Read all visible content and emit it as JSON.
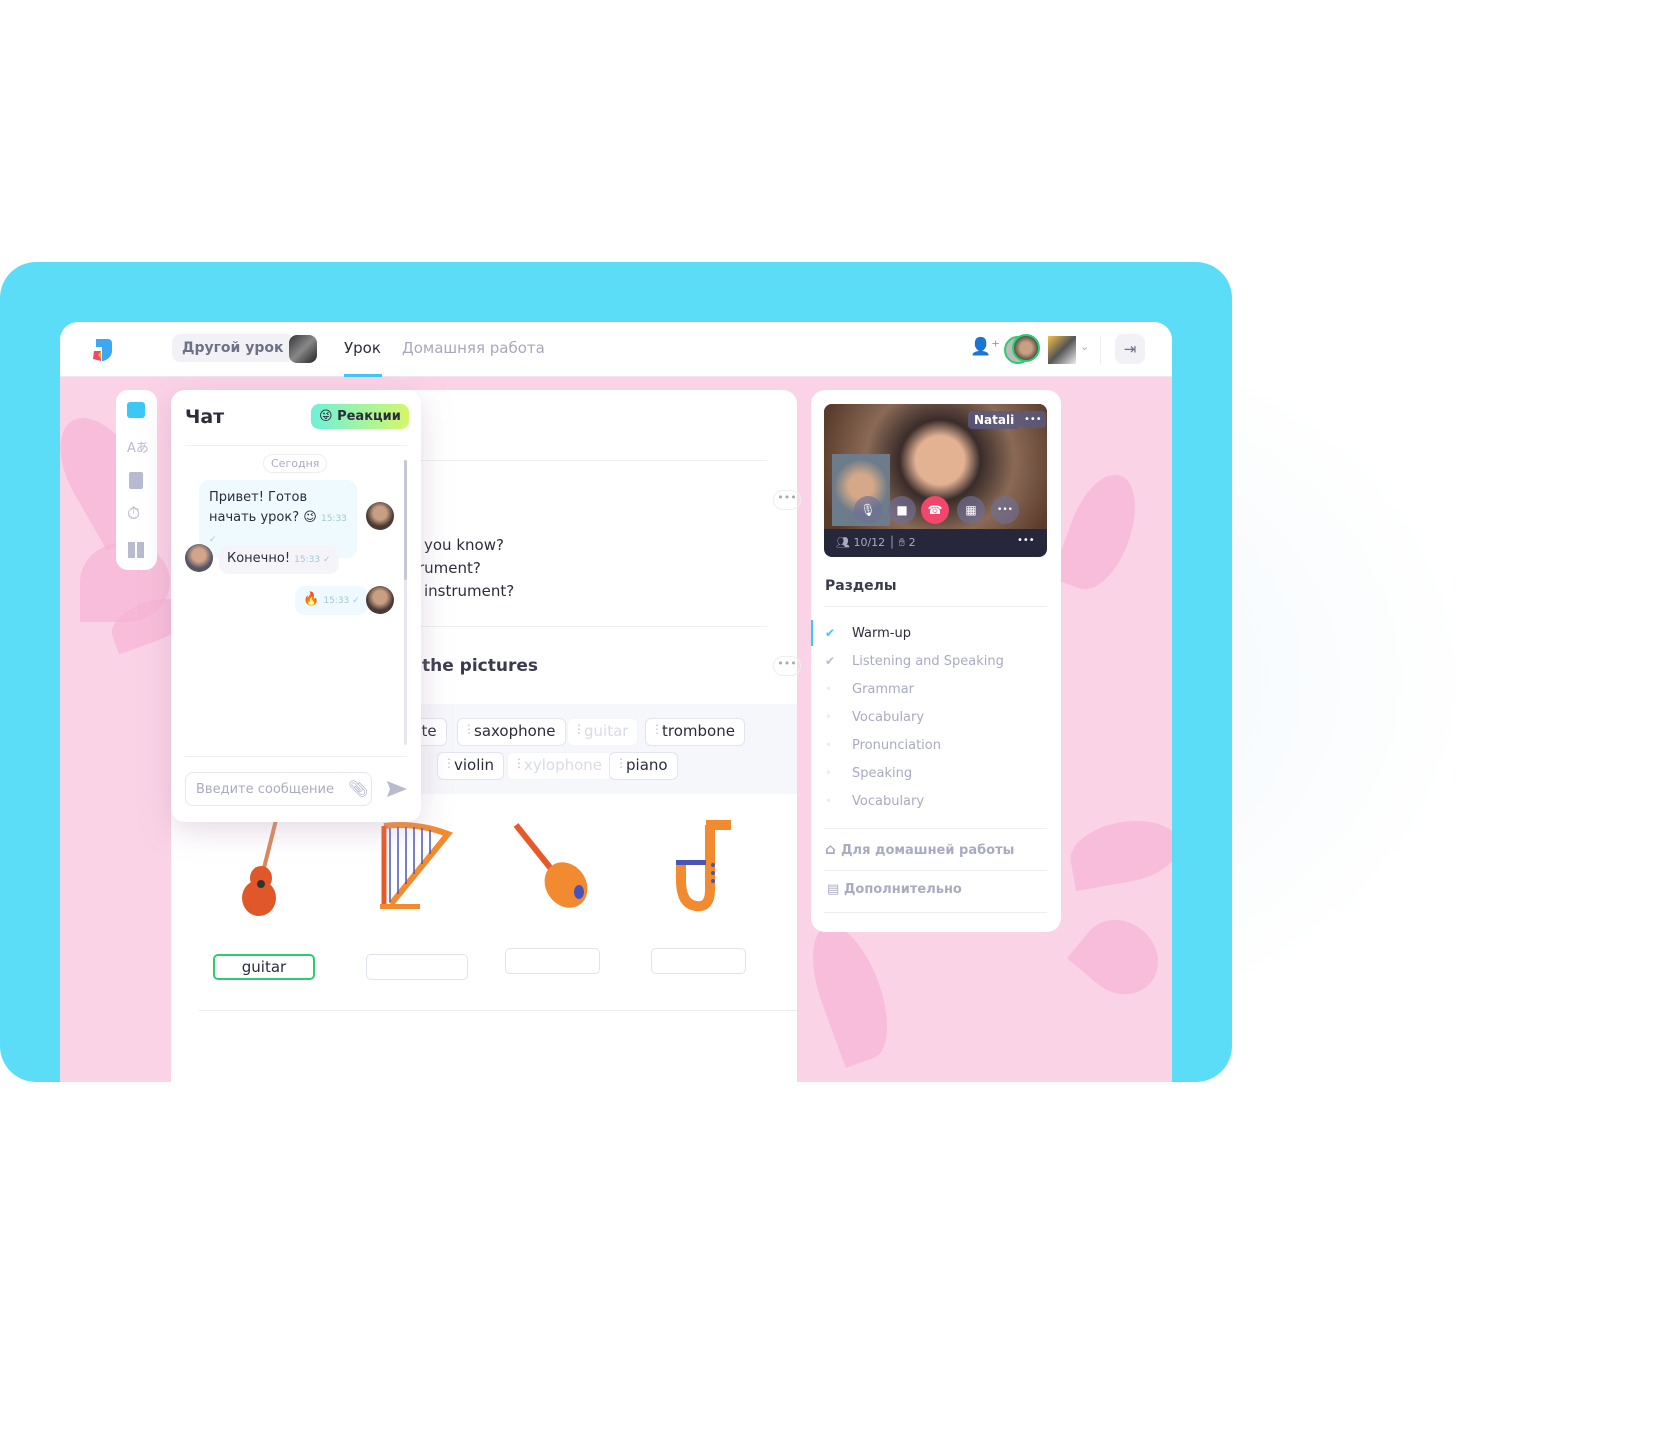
{
  "header": {
    "other_lesson": "Другой урок",
    "tabs": [
      {
        "label": "Урок",
        "active": true
      },
      {
        "label": "Домашняя работа",
        "active": false
      }
    ]
  },
  "chat": {
    "title": "Чат",
    "reactions_label": "Реакции",
    "date_label": "Сегодня",
    "messages": [
      {
        "text": "Привет! Готов начать урок? 😉",
        "time": "15:33 ✓",
        "side": "right"
      },
      {
        "text": "Конечно!",
        "time": "15:33 ✓",
        "side": "left"
      },
      {
        "text": "🔥",
        "time": "15:33 ✓",
        "side": "right"
      }
    ],
    "input_placeholder": "Введите сообщение"
  },
  "lesson": {
    "questions": [
      "you know?",
      "rument?",
      "instrument?"
    ],
    "task_title": "the pictures",
    "words_row1": [
      {
        "w": "ute",
        "used": false
      },
      {
        "w": "saxophone",
        "used": false
      },
      {
        "w": "guitar",
        "used": true
      },
      {
        "w": "trombone",
        "used": false
      }
    ],
    "words_row2": [
      {
        "w": "violin",
        "used": false
      },
      {
        "w": "xylophone",
        "used": true
      },
      {
        "w": "piano",
        "used": false
      }
    ],
    "answers": [
      "guitar",
      "",
      "",
      "",
      ""
    ]
  },
  "video": {
    "name": "Natali",
    "participants": "10/12",
    "hands": "2"
  },
  "sections": {
    "title": "Разделы",
    "items": [
      {
        "label": "Warm-up",
        "state": "current"
      },
      {
        "label": "Listening and Speaking",
        "state": "done"
      },
      {
        "label": "Grammar",
        "state": "todo"
      },
      {
        "label": "Vocabulary",
        "state": "todo"
      },
      {
        "label": "Pronunciation",
        "state": "todo"
      },
      {
        "label": "Speaking",
        "state": "todo"
      },
      {
        "label": "Vocabulary",
        "state": "todo"
      }
    ],
    "homework": "Для домашней работы",
    "extra": "Дополнительно"
  },
  "colors": {
    "accent": "#3CC8F5",
    "frame": "#5BDDF8",
    "pink": "#FBD3E7",
    "success": "#2ECC71",
    "hangup": "#F2466B"
  }
}
